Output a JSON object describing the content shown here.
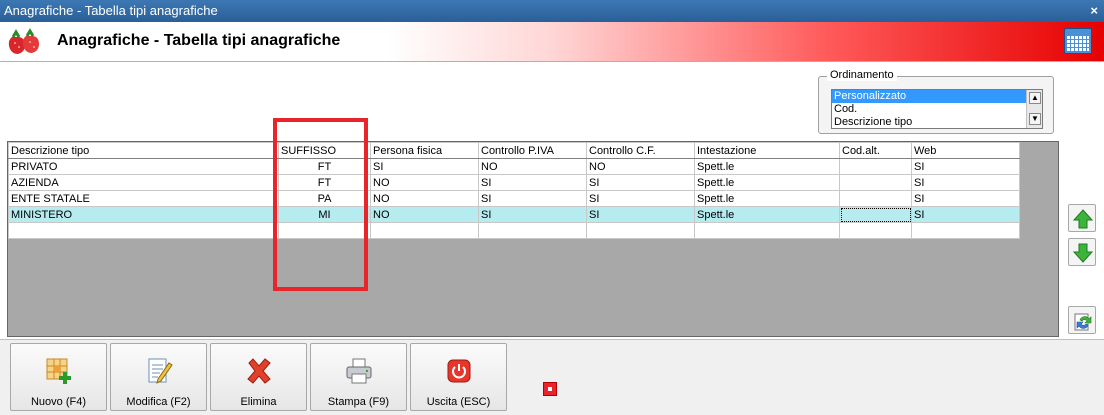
{
  "window": {
    "title": "Anagrafiche - Tabella tipi anagrafiche",
    "close_glyph": "×"
  },
  "header": {
    "title": "Anagrafiche - Tabella tipi anagrafiche",
    "logo_icon": "strawberries-logo",
    "right_icon": "calendar-icon"
  },
  "ordinamento": {
    "legend": "Ordinamento",
    "options": [
      "Personalizzato",
      "Cod.",
      "Descrizione tipo"
    ],
    "selected": "Personalizzato"
  },
  "table": {
    "columns": [
      "Descrizione tipo",
      "SUFFISSO",
      "Persona fisica",
      "Controllo P.IVA",
      "Controllo C.F.",
      "Intestazione",
      "Cod.alt.",
      "Web"
    ],
    "rows": [
      [
        "PRIVATO",
        "FT",
        "SI",
        "NO",
        "NO",
        "Spett.le",
        "",
        "SI"
      ],
      [
        "AZIENDA",
        "FT",
        "NO",
        "SI",
        "SI",
        "Spett.le",
        "",
        "SI"
      ],
      [
        "ENTE STATALE",
        "PA",
        "NO",
        "SI",
        "SI",
        "Spett.le",
        "",
        "SI"
      ],
      [
        "MINISTERO",
        "MI",
        "NO",
        "SI",
        "SI",
        "Spett.le",
        "",
        "SI"
      ]
    ],
    "selected_row": 3
  },
  "side_buttons": [
    "arrow-up-icon",
    "arrow-down-icon",
    "refresh-icon"
  ],
  "toolbar": {
    "nuovo": "Nuovo (F4)",
    "modifica": "Modifica (F2)",
    "elimina": "Elimina",
    "stampa": "Stampa (F9)",
    "uscita": "Uscita (ESC)"
  },
  "colors": {
    "accent_red": "#e8252a",
    "selected_row": "#b6ecf0",
    "list_selection": "#3399ff"
  }
}
